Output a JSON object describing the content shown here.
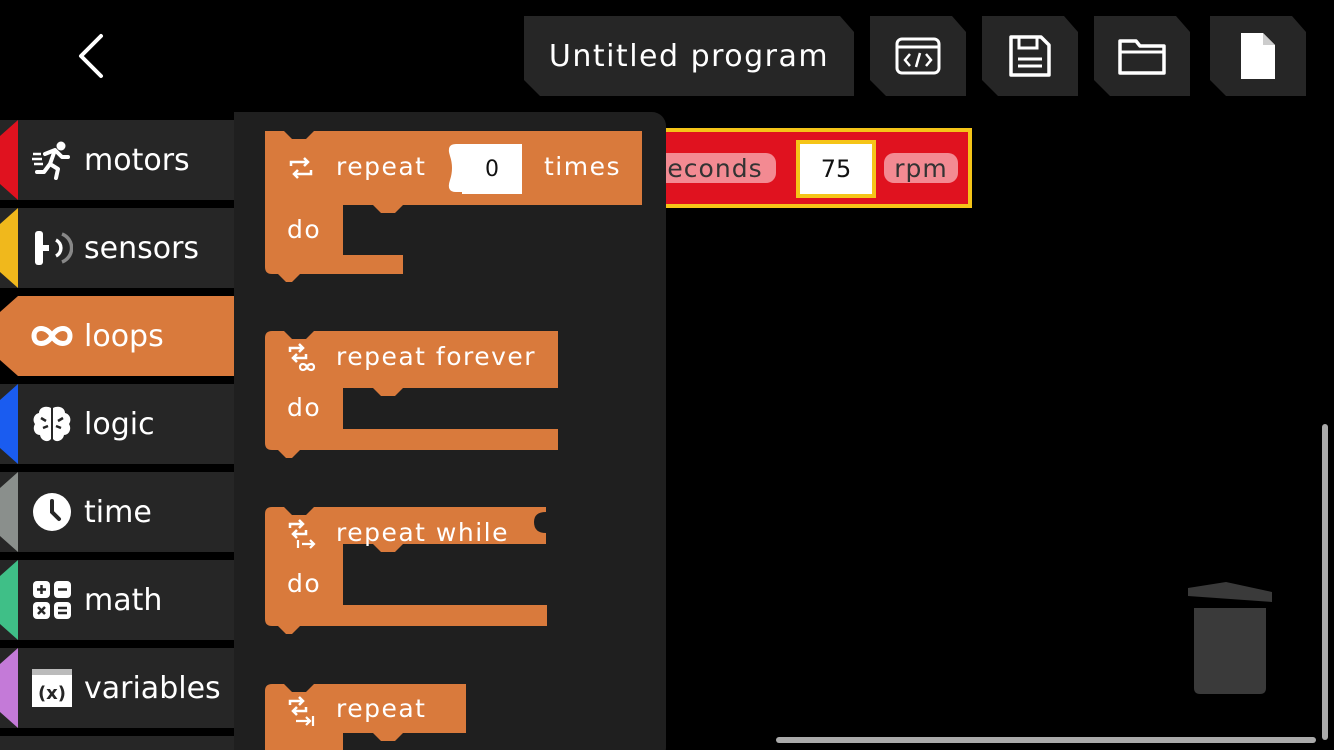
{
  "header": {
    "title": "Untitled program",
    "back_icon": "chevron-left-icon",
    "tools": [
      {
        "name": "code-view",
        "icon": "code-icon"
      },
      {
        "name": "save",
        "icon": "save-icon"
      },
      {
        "name": "open",
        "icon": "folder-icon"
      },
      {
        "name": "new",
        "icon": "file-icon"
      }
    ]
  },
  "categories": [
    {
      "label": "motors",
      "icon": "running-person-icon",
      "color": "#e0121f"
    },
    {
      "label": "sensors",
      "icon": "sensor-icon",
      "color": "#f0b81c"
    },
    {
      "label": "loops",
      "icon": "infinity-icon",
      "color": "#d97a3c",
      "active": true
    },
    {
      "label": "logic",
      "icon": "brain-icon",
      "color": "#1a5cf0"
    },
    {
      "label": "time",
      "icon": "clock-icon",
      "color": "#8a8f8c"
    },
    {
      "label": "math",
      "icon": "calculator-icon",
      "color": "#3fbf87"
    },
    {
      "label": "variables",
      "icon": "variable-icon",
      "color": "#c47ad8"
    }
  ],
  "flyout_blocks": {
    "repeat_times": {
      "label": "repeat",
      "value": "0",
      "suffix": "times",
      "do": "do",
      "icon": "repeat-icon"
    },
    "repeat_forever": {
      "label": "repeat forever",
      "do": "do",
      "icon": "repeat-forever-icon"
    },
    "repeat_while": {
      "label": "repeat while",
      "do": "do",
      "icon": "repeat-while-icon"
    },
    "repeat_until": {
      "label": "repeat",
      "icon": "repeat-until-icon"
    }
  },
  "workspace_block": {
    "seconds_label": "seconds",
    "speed_value": "75",
    "unit_label": "rpm"
  },
  "colors": {
    "loops": "#d97a3c",
    "motors": "#e0121f",
    "highlight": "#f5c518"
  }
}
